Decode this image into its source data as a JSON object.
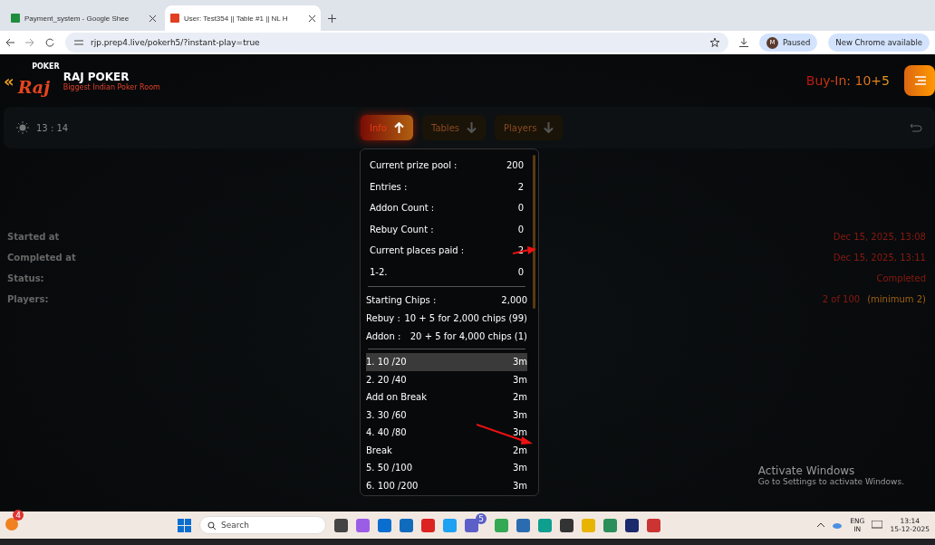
{
  "browser": {
    "tabs": [
      {
        "title": "Payment_system - Google Shee",
        "selected": false
      },
      {
        "title": "User: Test354 || Table #1 || NL H",
        "selected": true
      }
    ],
    "url": "rjp.prep4.live/pokerh5/?instant-play=true",
    "profile": {
      "initial": "M",
      "label": "Paused"
    },
    "update_button": "New Chrome available"
  },
  "app": {
    "back_chevron": "«",
    "brand": {
      "name": "RAJ POKER",
      "tagline": "Biggest Indian Poker Room",
      "logo_badge": "POKER",
      "logo_text": "Raj"
    },
    "buy_in": "Buy-In: 10+5",
    "clock": "13 : 14",
    "nav_tabs": [
      {
        "label": "Info",
        "selected": true
      },
      {
        "label": "Tables",
        "selected": false
      },
      {
        "label": "Players",
        "selected": false
      }
    ],
    "details": [
      {
        "label": "Started at",
        "value": "Dec 15, 2025, 13:08"
      },
      {
        "label": "Completed at",
        "value": "Dec 15, 2025, 13:11"
      },
      {
        "label": "Status:",
        "value": "Completed"
      },
      {
        "label": "Players:",
        "value": "2 of 100",
        "note": "(minimum 2)"
      }
    ]
  },
  "info_panel": {
    "stats": [
      {
        "label": "Current prize pool :",
        "value": "200"
      },
      {
        "label": "Entries :",
        "value": "2"
      },
      {
        "label": "Addon Count :",
        "value": "0"
      },
      {
        "label": "Rebuy Count :",
        "value": "0"
      },
      {
        "label": "Current places paid :",
        "value": "2"
      },
      {
        "label": "1-2.",
        "value": "0"
      }
    ],
    "chips": [
      {
        "label": "Starting Chips :",
        "value": "2,000"
      },
      {
        "label": "Rebuy :",
        "value": "10 + 5 for 2,000 chips (99)"
      },
      {
        "label": "Addon :",
        "value": "20 + 5 for 4,000 chips (1)"
      }
    ],
    "levels": [
      {
        "name": "1. 10 /20",
        "duration": "3m",
        "selected": true
      },
      {
        "name": "2. 20 /40",
        "duration": "3m",
        "selected": false
      },
      {
        "name": "Add on Break",
        "duration": "2m",
        "selected": false
      },
      {
        "name": "3. 30 /60",
        "duration": "3m",
        "selected": false
      },
      {
        "name": "4. 40 /80",
        "duration": "3m",
        "selected": false
      },
      {
        "name": "Break",
        "duration": "2m",
        "selected": false
      },
      {
        "name": "5. 50 /100",
        "duration": "3m",
        "selected": false
      },
      {
        "name": "6. 100 /200",
        "duration": "3m",
        "selected": false
      }
    ]
  },
  "watermark": {
    "title": "Activate Windows",
    "subtitle": "Go to Settings to activate Windows."
  },
  "taskbar": {
    "notification_count": "4",
    "search_placeholder": "Search",
    "teams_badge": "5",
    "language": "ENG",
    "region": "IN",
    "time": "13:14",
    "date": "15-12-2025"
  }
}
